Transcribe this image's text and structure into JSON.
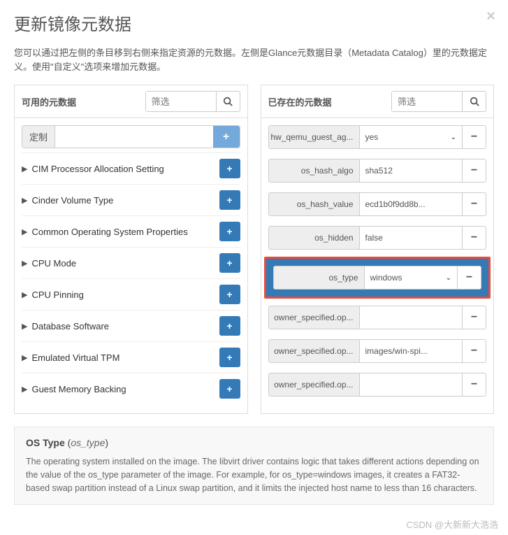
{
  "modal": {
    "title": "更新镜像元数据",
    "intro": "您可以通过把左侧的条目移到右侧来指定资源的元数据。左侧是Glance元数据目录（Metadata Catalog）里的元数据定义。使用\"自定义\"选项来增加元数据。"
  },
  "left": {
    "title": "可用的元数据",
    "filter_placeholder": "筛选",
    "custom_label": "定制",
    "items": [
      "CIM Processor Allocation Setting",
      "Cinder Volume Type",
      "Common Operating System Properties",
      "CPU Mode",
      "CPU Pinning",
      "Database Software",
      "Emulated Virtual TPM",
      "Guest Memory Backing"
    ]
  },
  "right": {
    "title": "已存在的元数据",
    "filter_placeholder": "筛选",
    "rows": [
      {
        "key": "hw_qemu_guest_ag...",
        "value": "yes",
        "select": true
      },
      {
        "key": "os_hash_algo",
        "value": "sha512",
        "select": false
      },
      {
        "key": "os_hash_value",
        "value": "ecd1b0f9dd8b...",
        "select": false
      },
      {
        "key": "os_hidden",
        "value": "false",
        "select": false
      },
      {
        "key": "os_type",
        "value": "windows",
        "select": true,
        "highlight": true
      },
      {
        "key": "owner_specified.op...",
        "value": "",
        "select": false
      },
      {
        "key": "owner_specified.op...",
        "value": "images/win-spi...",
        "select": false
      },
      {
        "key": "owner_specified.op...",
        "value": "",
        "select": false
      }
    ]
  },
  "desc": {
    "title_main": "OS Type",
    "title_key": "os_type",
    "text": "The operating system installed on the image. The libvirt driver contains logic that takes different actions depending on the value of the os_type parameter of the image. For example, for os_type=windows images, it creates a FAT32-based swap partition instead of a Linux swap partition, and it limits the injected host name to less than 16 characters."
  },
  "watermark": "CSDN @大新新大浩浩"
}
